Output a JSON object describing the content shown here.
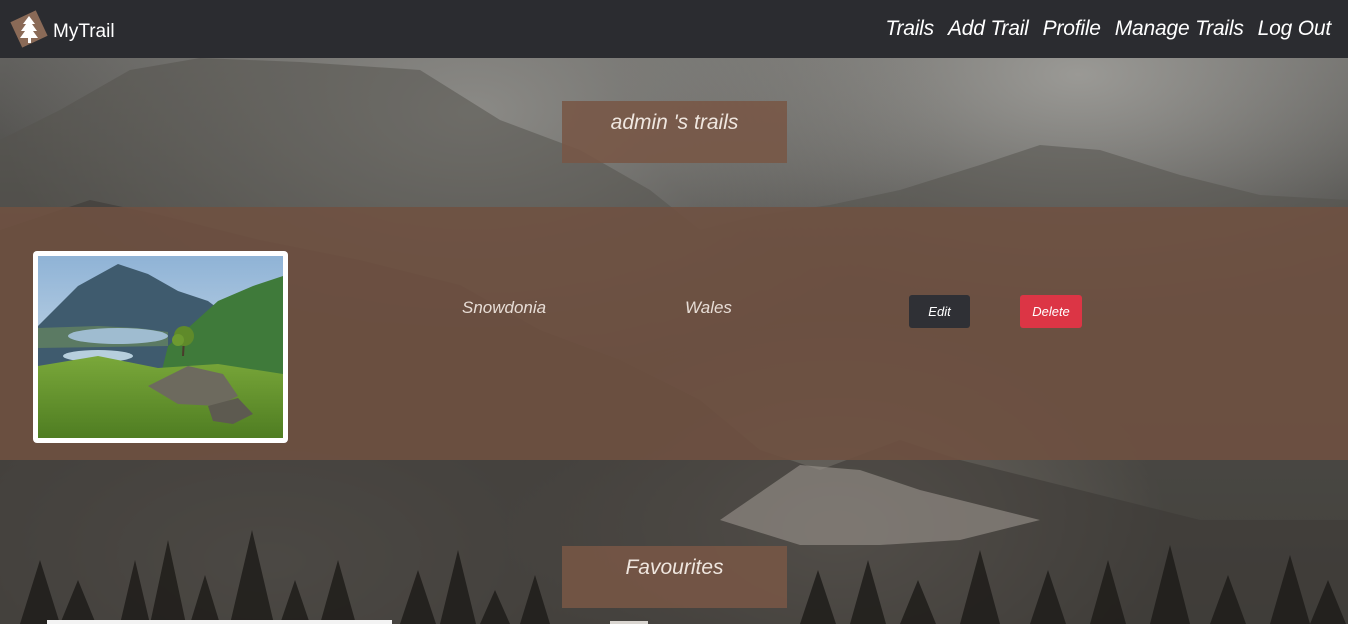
{
  "navbar": {
    "brand": "MyTrail",
    "links": [
      "Trails",
      "Add Trail",
      "Profile",
      "Manage Trails",
      "Log Out"
    ]
  },
  "trails_section": {
    "title": "admin 's trails"
  },
  "trail": {
    "name": "Snowdonia",
    "region": "Wales",
    "edit_label": "Edit",
    "delete_label": "Delete"
  },
  "favourites_section": {
    "title": "Favourites"
  },
  "colors": {
    "navbar": "#2b2c30",
    "panel": "#705141",
    "edit_button": "#2f3035",
    "delete_button": "#dc3545"
  },
  "icons": {
    "brand_logo": "tree-logo-icon"
  }
}
